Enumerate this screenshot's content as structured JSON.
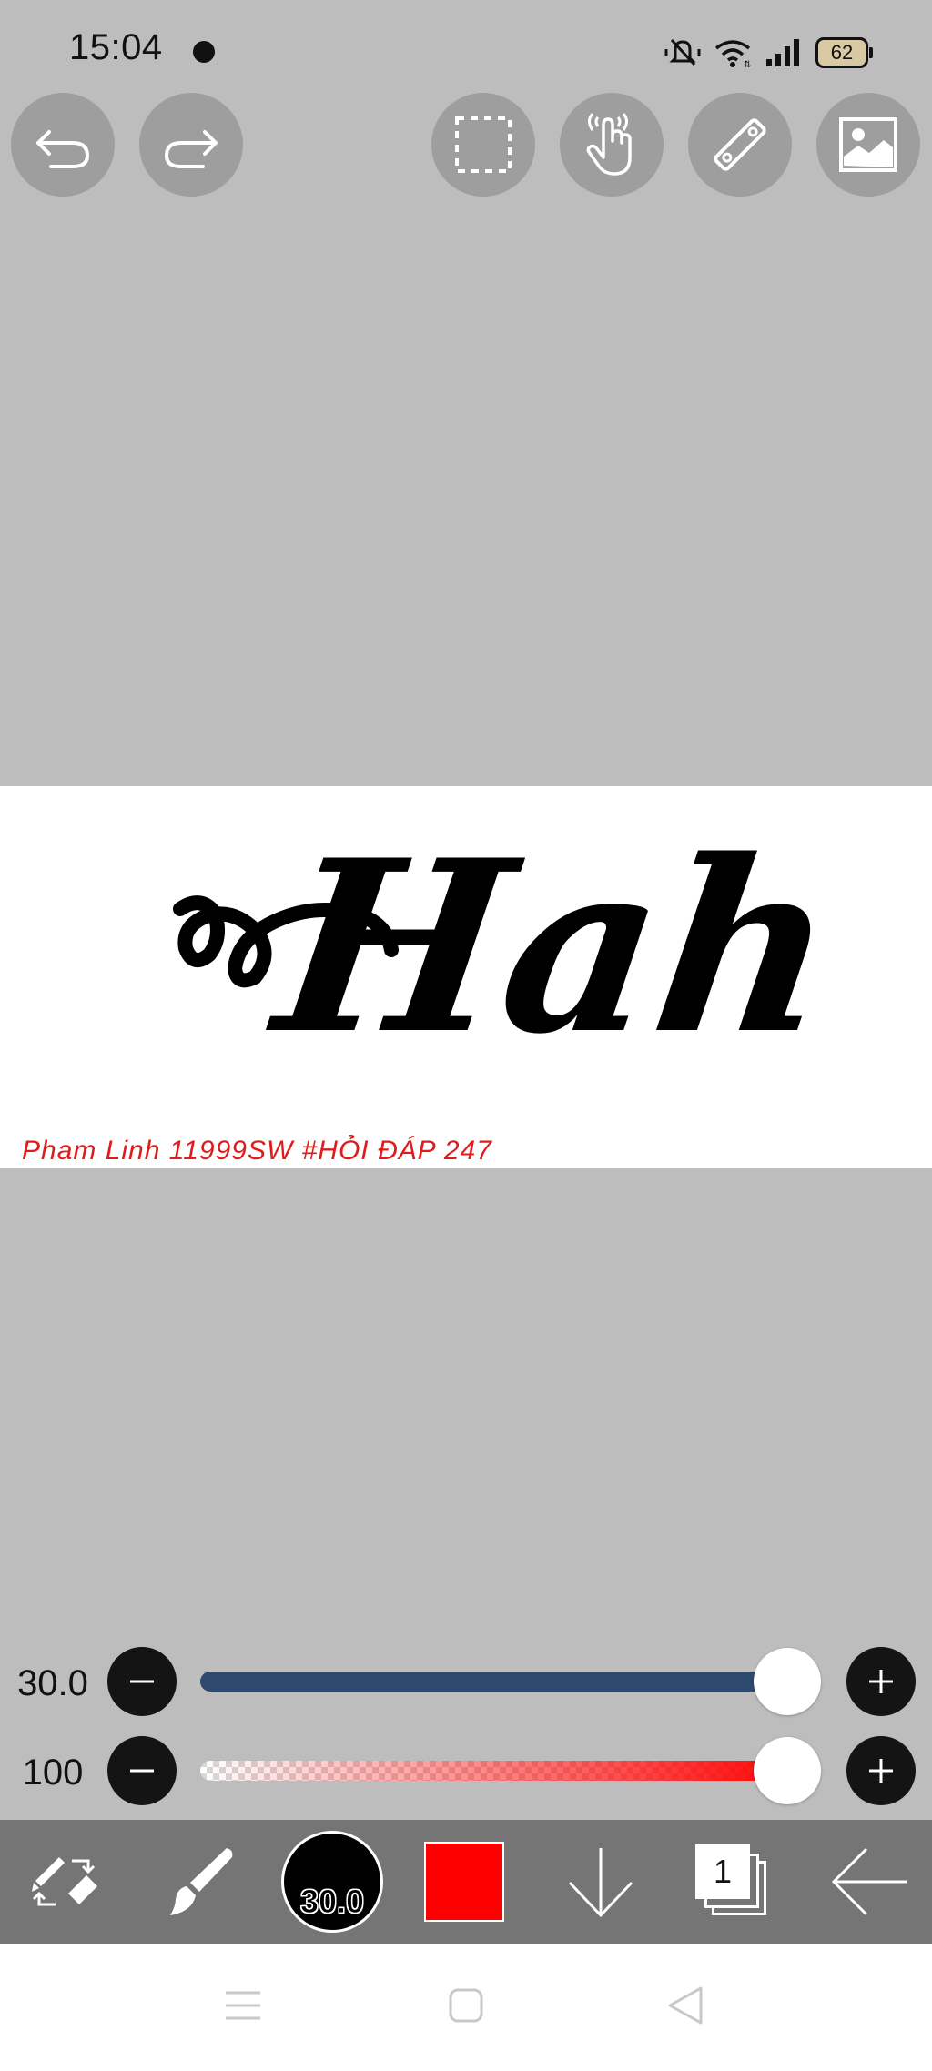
{
  "status_bar": {
    "time": "15:04",
    "battery_level": "62",
    "icons": [
      "notification-dot-icon",
      "mute-icon",
      "wifi-icon",
      "cellular-signal-icon",
      "battery-icon"
    ]
  },
  "top_toolbar": {
    "buttons": [
      "undo-icon",
      "redo-icon",
      "selection-icon",
      "hand-icon",
      "ruler-icon",
      "image-icon"
    ]
  },
  "canvas": {
    "artwork_text": "Hah",
    "caption": "Pham Linh 11999SW #HỎI ĐÁP 247"
  },
  "brush_size_slider": {
    "value": "30.0",
    "level": 1.0,
    "track_color": "#2d4a6e"
  },
  "opacity_slider": {
    "value": "100",
    "level": 1.0,
    "track_color": "#ff2020"
  },
  "bottom_toolbar": {
    "brush_size_label": "30.0",
    "current_color": "#ff0000",
    "layer_count": "1",
    "icons": [
      "swap-tool-icon",
      "brush-icon",
      "brush-size-icon",
      "color-swatch",
      "download-icon",
      "layers-icon",
      "back-arrow-icon"
    ]
  },
  "nav_bar": {
    "icons": [
      "menu-icon",
      "home-icon",
      "back-icon"
    ]
  },
  "colors": {
    "background": "#bdbdbd",
    "toolbar": "#757575",
    "button": "#9e9e9e"
  }
}
